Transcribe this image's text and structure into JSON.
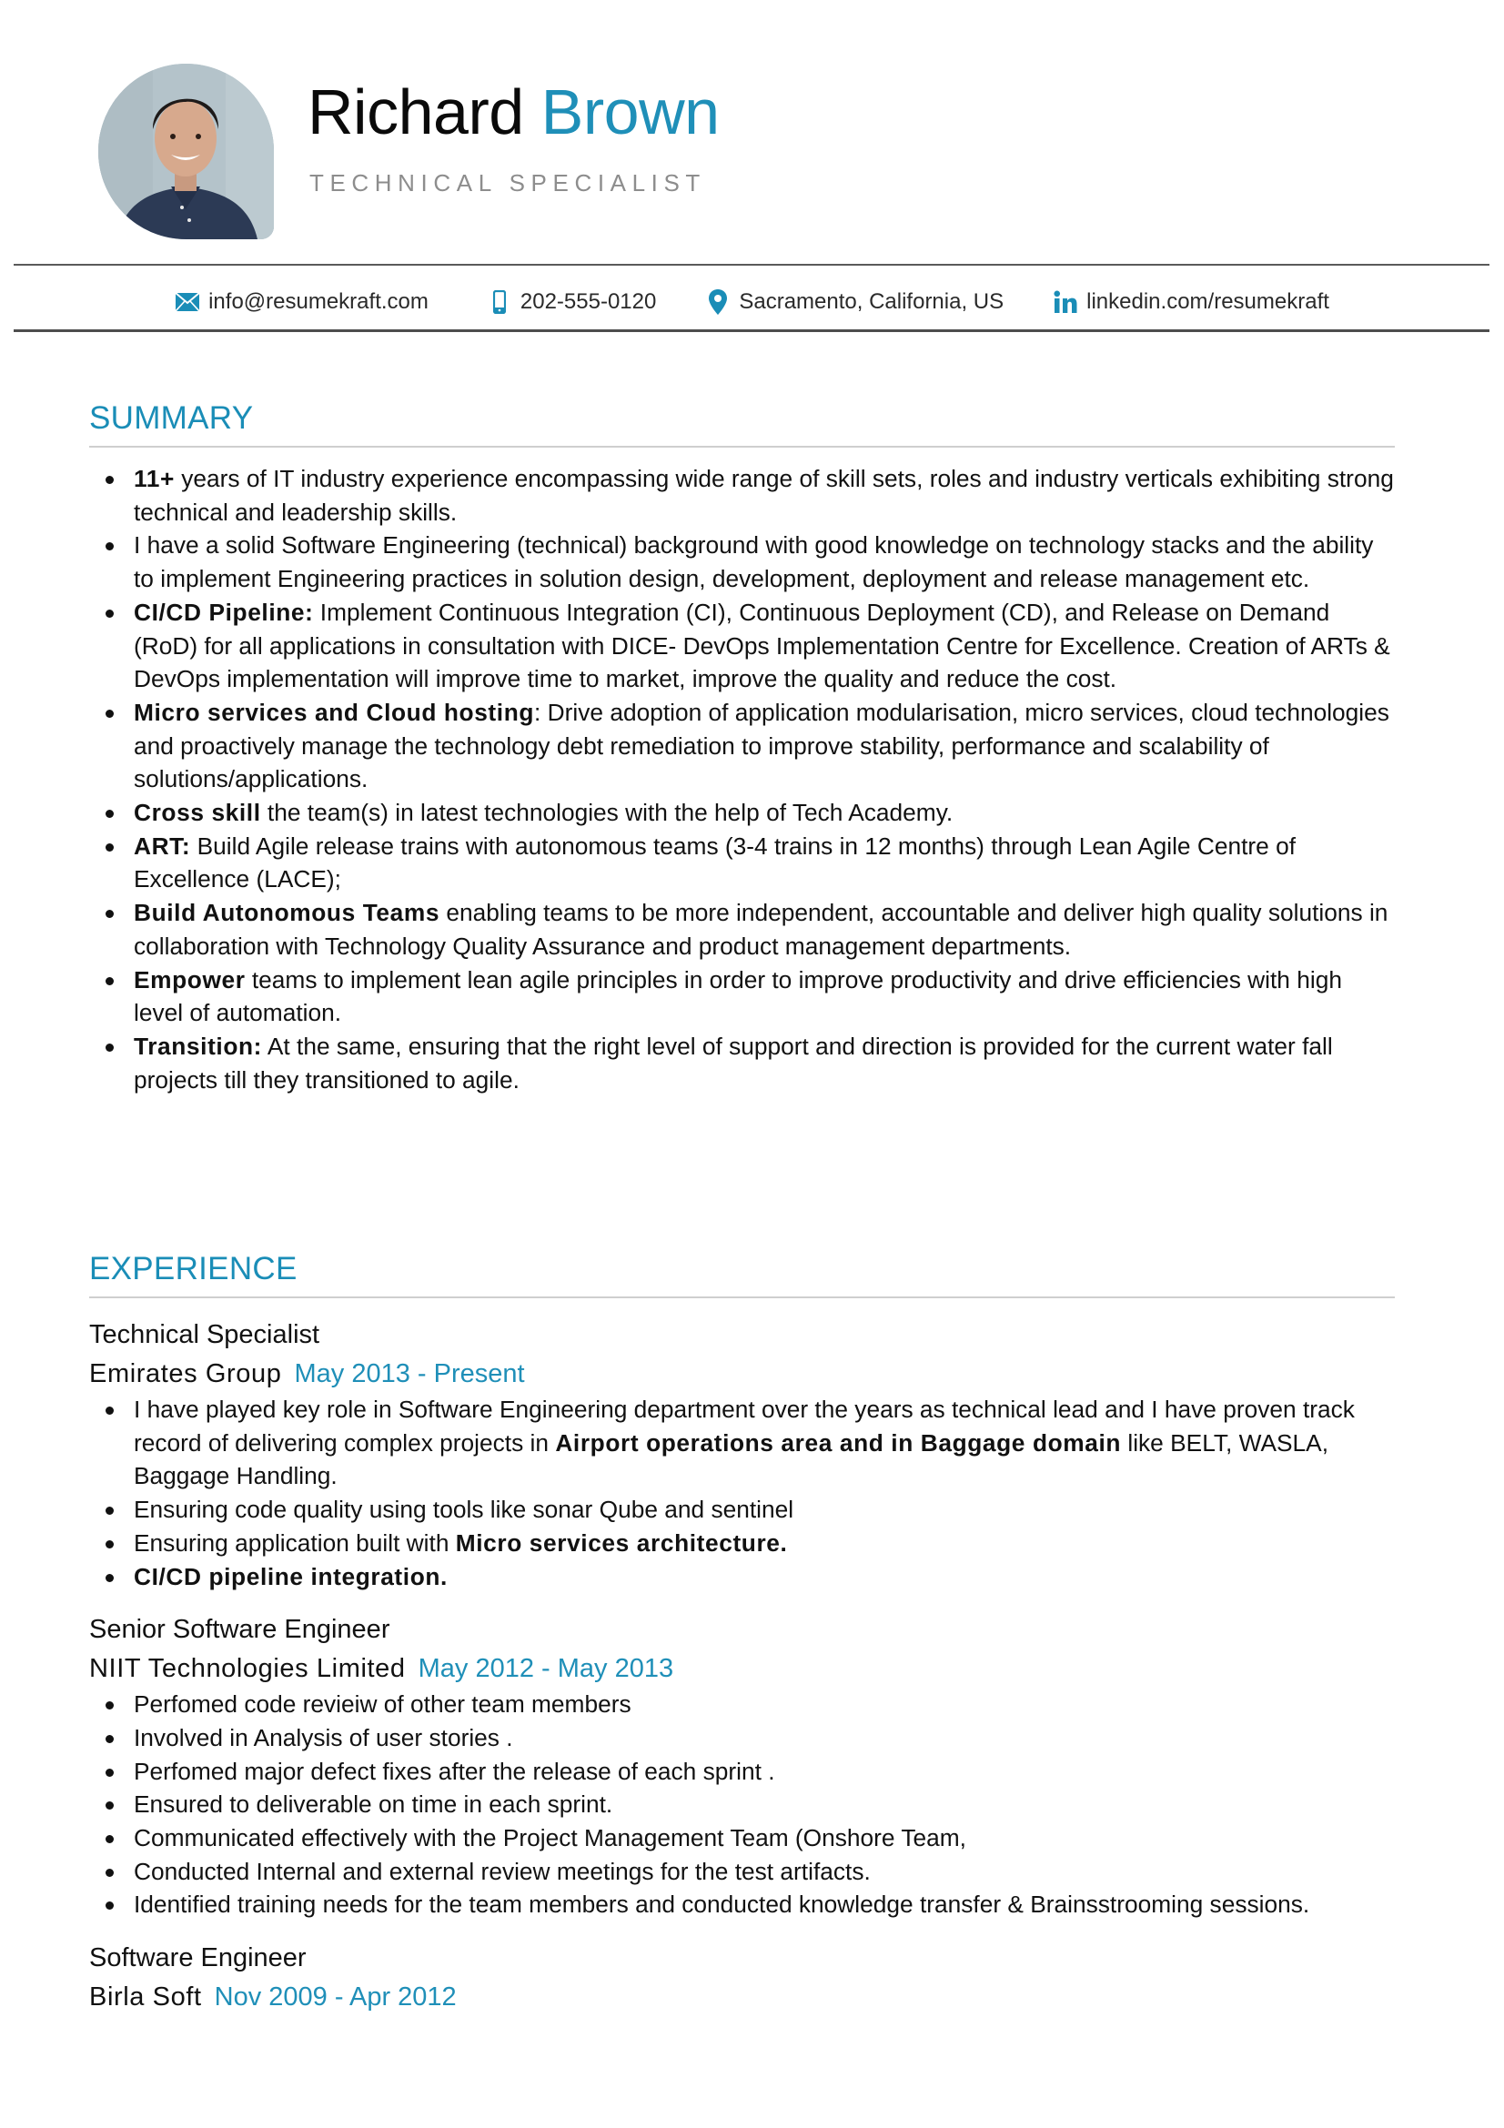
{
  "header": {
    "first_name": "Richard",
    "last_name": "Brown",
    "job_title": "TECHNICAL SPECIALIST",
    "accent_color": "#1f8fb8"
  },
  "contact": {
    "email": {
      "icon": "envelope-icon",
      "text": "info@resumekraft.com"
    },
    "phone": {
      "icon": "mobile-phone-icon",
      "text": "202-555-0120"
    },
    "location": {
      "icon": "map-pin-icon",
      "text": "Sacramento, California, US"
    },
    "linkedin": {
      "icon": "linkedin-icon",
      "text": "linkedin.com/resumekraft"
    }
  },
  "summary": {
    "title": "SUMMARY",
    "items": [
      {
        "bold": "11+",
        "text": " years of IT industry experience encompassing wide range of skill sets, roles and industry verticals exhibiting strong technical and leadership skills."
      },
      {
        "bold": "",
        "text": "I have a solid Software Engineering (technical) background with good knowledge on technology stacks and the ability to implement Engineering practices in solution design, development, deployment and release management etc."
      },
      {
        "bold": "CI/CD Pipeline:",
        "text": " Implement Continuous Integration (CI), Continuous Deployment (CD), and Release on Demand (RoD) for all applications in consultation with DICE- DevOps Implementation Centre for Excellence. Creation of ARTs & DevOps implementation will improve time to market, improve the quality and reduce the cost."
      },
      {
        "bold": "Micro services and Cloud hosting",
        "text": ": Drive adoption of application modularisation, micro services, cloud technologies and proactively manage the technology debt remediation to improve stability, performance and scalability of solutions/applications."
      },
      {
        "bold": "Cross skill",
        "text": " the team(s) in latest technologies with the help of Tech Academy."
      },
      {
        "bold": "ART:",
        "text": " Build Agile release trains with autonomous teams (3-4 trains in 12 months) through Lean Agile Centre of Excellence (LACE);"
      },
      {
        "bold": "Build Autonomous Teams",
        "text": " enabling teams to be more independent, accountable and deliver high quality solutions in collaboration with Technology Quality Assurance and product management departments."
      },
      {
        "bold": "Empower",
        "text": " teams to implement lean agile principles in order to improve productivity and drive efficiencies with high level of automation."
      },
      {
        "bold": "Transition:",
        "text": " At the same, ensuring that the right level of support and direction is provided for the current water fall projects till they transitioned to agile."
      }
    ]
  },
  "experience": {
    "title": "EXPERIENCE",
    "jobs": [
      {
        "role": "Technical Specialist",
        "company": "Emirates Group",
        "dates": "May 2013 - Present",
        "bullets": [
          {
            "segments": [
              {
                "t": "I have played key role in Software Engineering department over the years as technical lead and I have proven track record of delivering complex projects in ",
                "b": false
              },
              {
                "t": "Airport operations area and in Baggage domain",
                "b": true
              },
              {
                "t": " like BELT, WASLA, Baggage Handling.",
                "b": false
              }
            ]
          },
          {
            "segments": [
              {
                "t": "Ensuring code quality using tools like  sonar Qube and sentinel",
                "b": false
              }
            ]
          },
          {
            "segments": [
              {
                "t": "Ensuring application built with ",
                "b": false
              },
              {
                "t": "Micro services architecture.",
                "b": true
              }
            ]
          },
          {
            "segments": [
              {
                "t": "CI/CD pipeline integration.",
                "b": true
              }
            ]
          }
        ]
      },
      {
        "role": "Senior Software Engineer",
        "company": "NIIT Technologies Limited",
        "dates": "May 2012 - May 2013",
        "bullets": [
          {
            "segments": [
              {
                "t": "Perfomed code revieiw of other team members",
                "b": false
              }
            ]
          },
          {
            "segments": [
              {
                "t": "Involved in Analysis of user stories .",
                "b": false
              }
            ]
          },
          {
            "segments": [
              {
                "t": "Perfomed major defect fixes after the release of each sprint .",
                "b": false
              }
            ]
          },
          {
            "segments": [
              {
                "t": "Ensured to deliverable on time in each sprint.",
                "b": false
              }
            ]
          },
          {
            "segments": [
              {
                "t": "Communicated effectively with the Project Management Team (Onshore Team,",
                "b": false
              }
            ]
          },
          {
            "segments": [
              {
                "t": "Conducted Internal and external review meetings for the test artifacts.",
                "b": false
              }
            ]
          },
          {
            "segments": [
              {
                "t": "Identified training needs for the team members and conducted knowledge transfer & Brainsstrooming sessions.",
                "b": false
              }
            ]
          }
        ]
      },
      {
        "role": "Software Engineer",
        "company": "Birla Soft",
        "dates": "Nov 2009 - Apr 2012",
        "bullets": []
      }
    ]
  }
}
